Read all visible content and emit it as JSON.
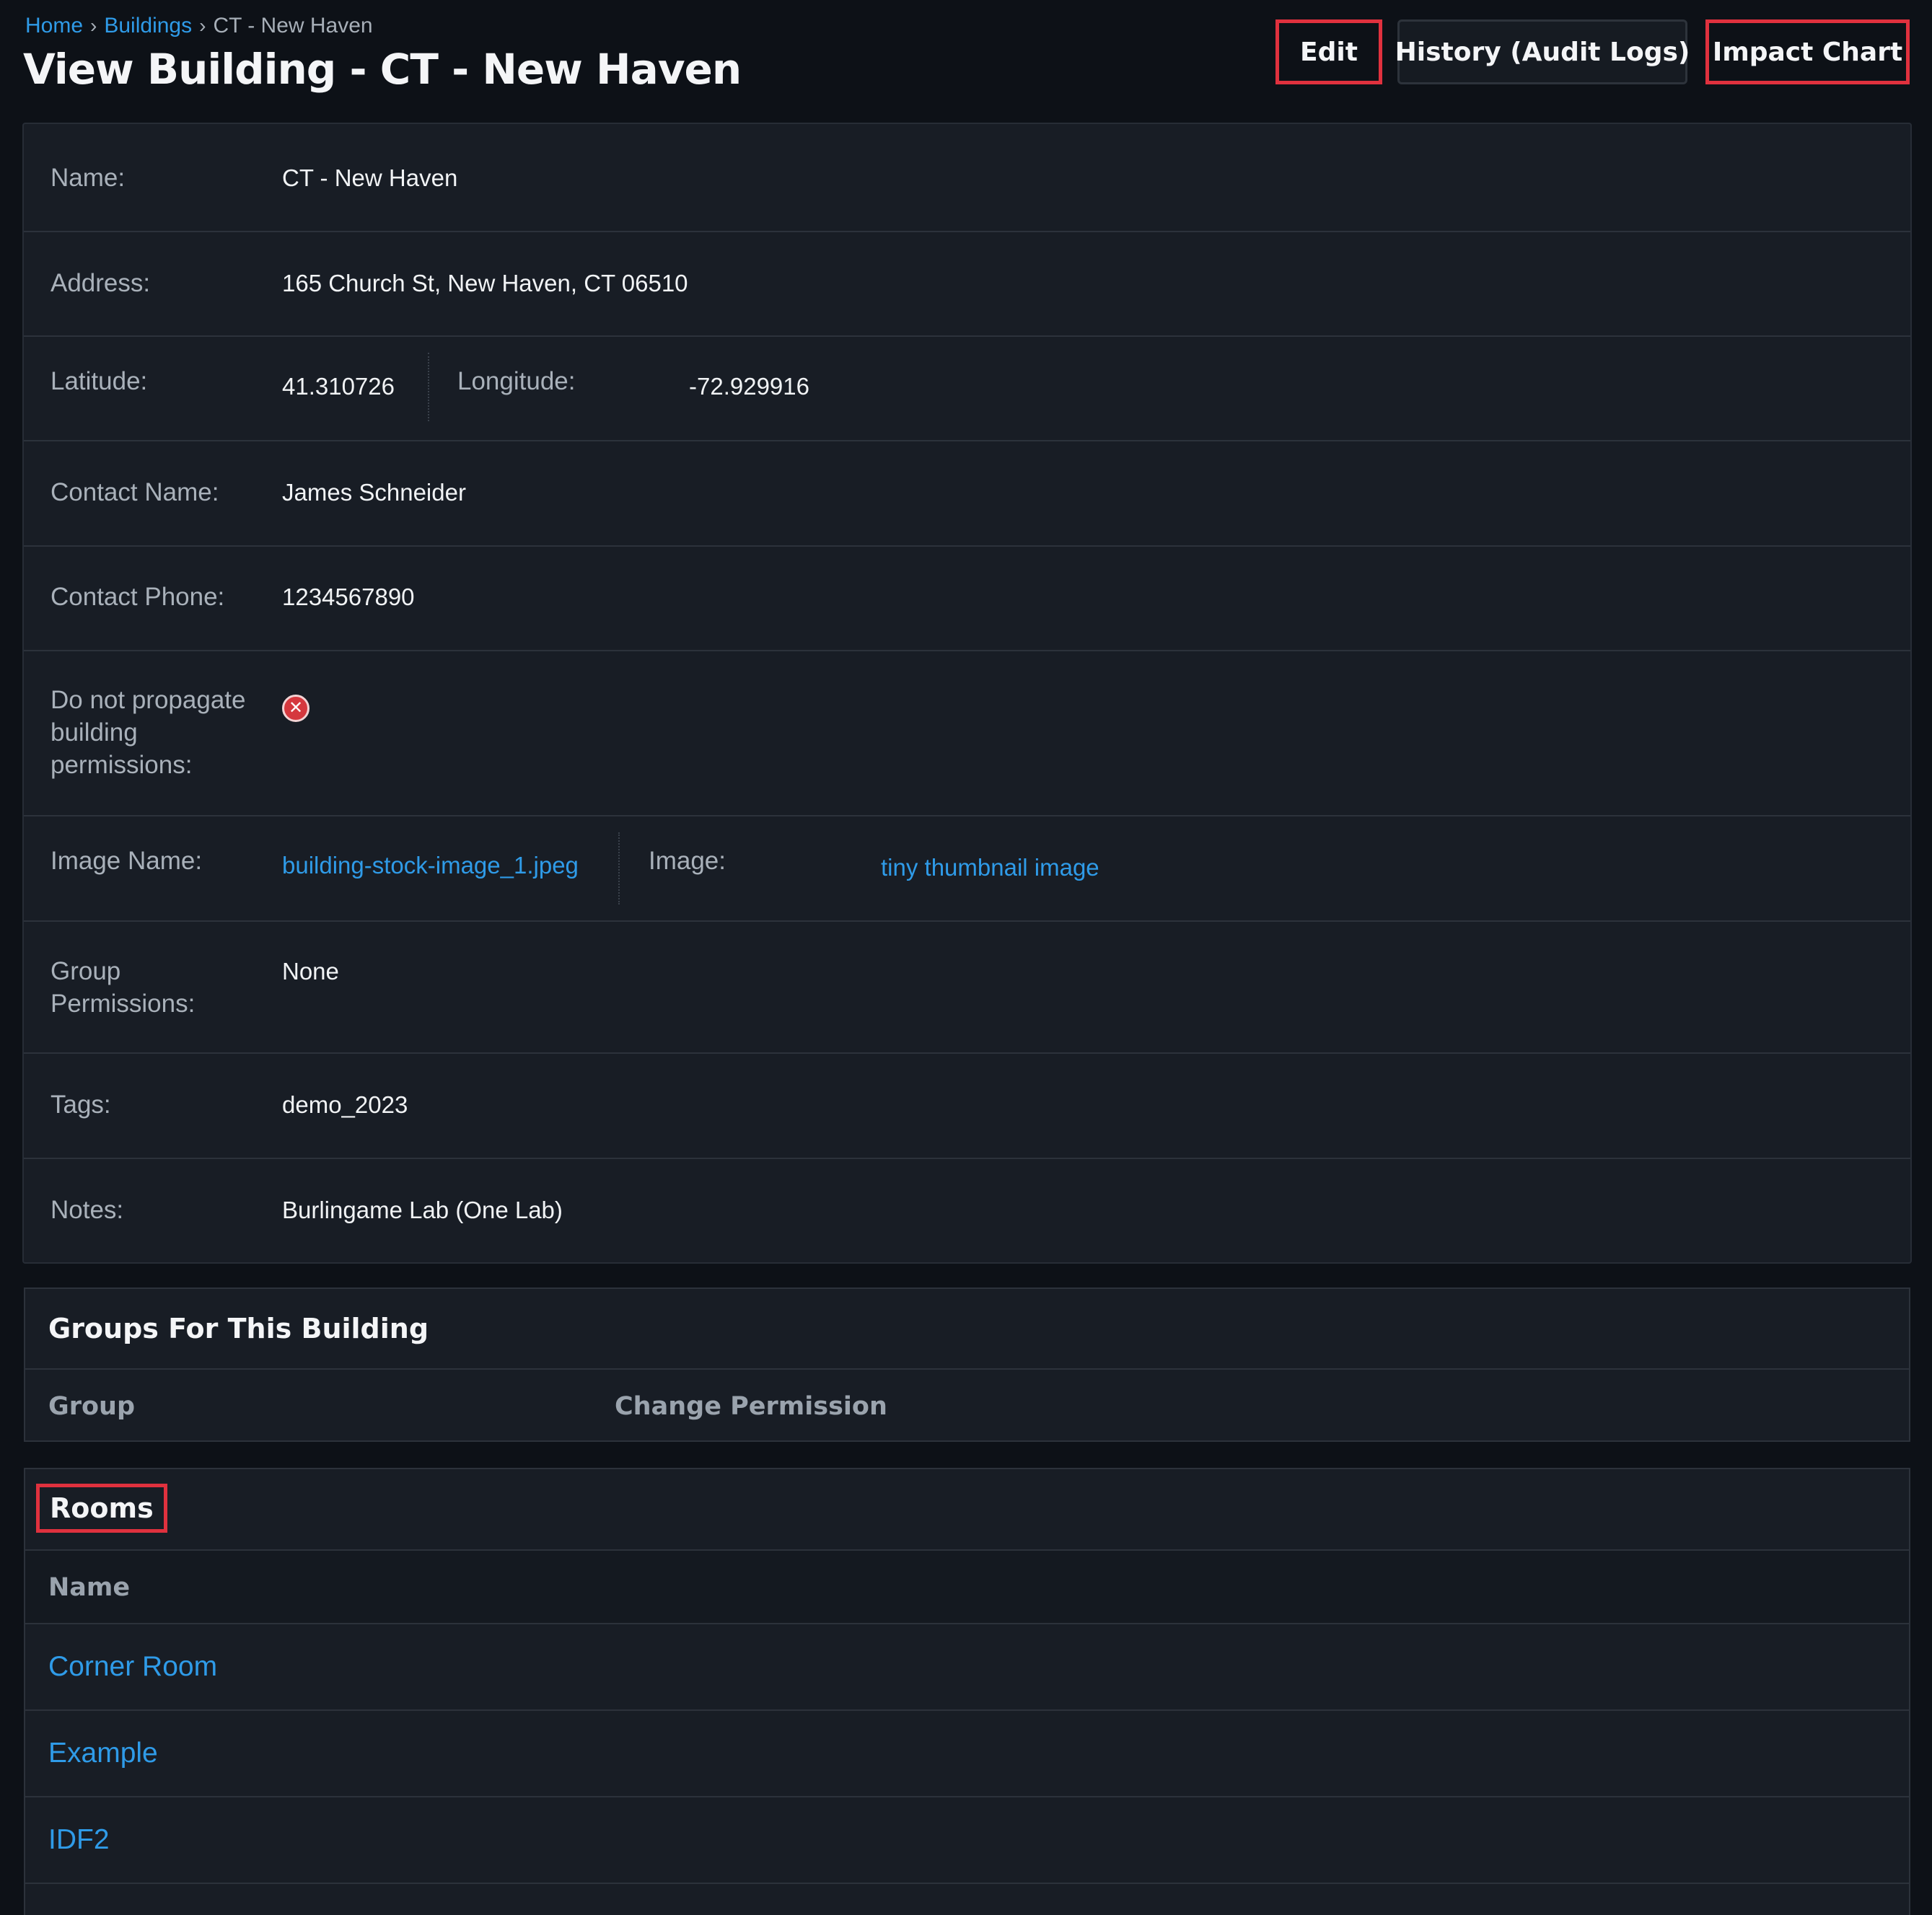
{
  "breadcrumb": {
    "home": "Home",
    "buildings": "Buildings",
    "current": "CT - New Haven",
    "separator": "›"
  },
  "page_title": "View Building - CT - New Haven",
  "actions": {
    "edit": "Edit",
    "history": "History (Audit Logs)",
    "impact_chart": "Impact Chart"
  },
  "details": {
    "name": {
      "label": "Name:",
      "value": "CT - New Haven"
    },
    "address": {
      "label": "Address:",
      "value": "165 Church St, New Haven, CT 06510"
    },
    "latitude": {
      "label": "Latitude:",
      "value": "41.310726"
    },
    "longitude": {
      "label": "Longitude:",
      "value": "-72.929916"
    },
    "contact_name": {
      "label": "Contact Name:",
      "value": "James Schneider"
    },
    "contact_phone": {
      "label": "Contact Phone:",
      "value": "1234567890"
    },
    "no_propagate": {
      "label": "Do not propagate building permissions:",
      "value_icon": "x-circle-icon",
      "value": false
    },
    "image_name": {
      "label": "Image Name:",
      "value": "building-stock-image_1.jpeg"
    },
    "image": {
      "label": "Image:",
      "value": "tiny thumbnail image"
    },
    "group_permissions": {
      "label": "Group Permissions:",
      "value": "None"
    },
    "tags": {
      "label": "Tags:",
      "value": "demo_2023"
    },
    "notes": {
      "label": "Notes:",
      "value": "Burlingame Lab (One Lab)"
    }
  },
  "groups_card": {
    "title": "Groups For This Building",
    "columns": [
      "Group",
      "Change Permission"
    ]
  },
  "rooms_card": {
    "title": "Rooms",
    "columns": [
      "Name"
    ],
    "rows": [
      "Corner Room",
      "Example",
      "IDF2"
    ]
  },
  "colors": {
    "background": "#0d1117",
    "panel": "#181d25",
    "link": "#2f9be8",
    "highlight": "#e0313e",
    "error_icon": "#d5383e"
  }
}
